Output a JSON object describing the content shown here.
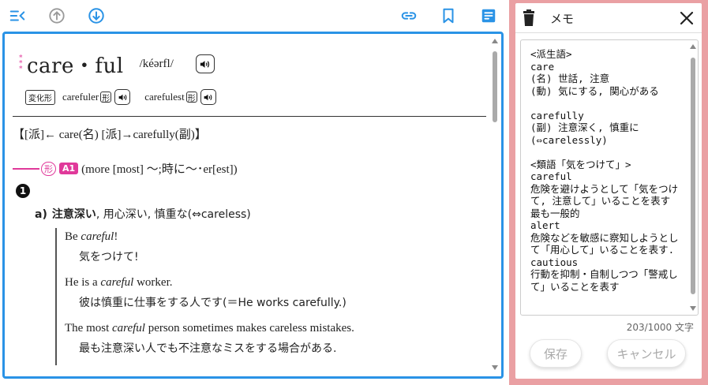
{
  "colors": {
    "accent": "#2a93e6",
    "pink": "#e0399a",
    "memo_frame": "#eaa0a3"
  },
  "toolbar": {
    "icons": [
      "menu-collapse-icon",
      "arrow-up-circle-icon",
      "arrow-down-circle-icon",
      "link-icon",
      "bookmark-icon",
      "memo-edit-icon"
    ]
  },
  "entry": {
    "stars": [
      "*",
      "*",
      "*"
    ],
    "headword": "care・ful",
    "pronunciation": "/kéərfl/",
    "inflection_label": "変化形",
    "comparative": "carefuler",
    "superlative": "carefulest",
    "pos_short": "形",
    "etymology": "【[派]← care(名) [派]→carefully(副)】",
    "pos_mark": "形",
    "level": "A1",
    "pos_note": "(more [most] 〜;時に〜･er[est])",
    "sense_number": "1",
    "sub_sense_label": "a)",
    "sub_sense_bold": "注意深い",
    "sub_sense_rest": ", 用心深い, 慎重な(⇔careless)",
    "examples": [
      {
        "en_pre": "Be ",
        "en_em": "careful",
        "en_post": "!",
        "ja": "気をつけて!"
      },
      {
        "en_pre": "He is a ",
        "en_em": "careful",
        "en_post": " worker.",
        "ja": "彼は慎重に仕事をする人です(＝He works carefully.)"
      },
      {
        "en_pre": "The most ",
        "en_em": "careful",
        "en_post": " person sometimes makes careless mistakes.",
        "ja": "最も注意深い人でも不注意なミスをする場合がある."
      }
    ]
  },
  "memo": {
    "title": "メモ",
    "text": "<派生語>\ncare\n(名) 世話, 注意\n(動) 気にする, 関心がある\n\ncarefully\n(副) 注意深く, 慎重に\n(⇔carelessly)\n\n<類語「気をつけて」>\ncareful\n危険を避けようとして「気をつけて, 注意して」いることを表す　最も一般的\nalert\n危険などを敏感に察知しようとして「用心して」いることを表す.\ncautious\n行動を抑制・自制しつつ「警戒して」いることを表す",
    "char_count": "203/1000 文字",
    "save_label": "保存",
    "cancel_label": "キャンセル"
  }
}
